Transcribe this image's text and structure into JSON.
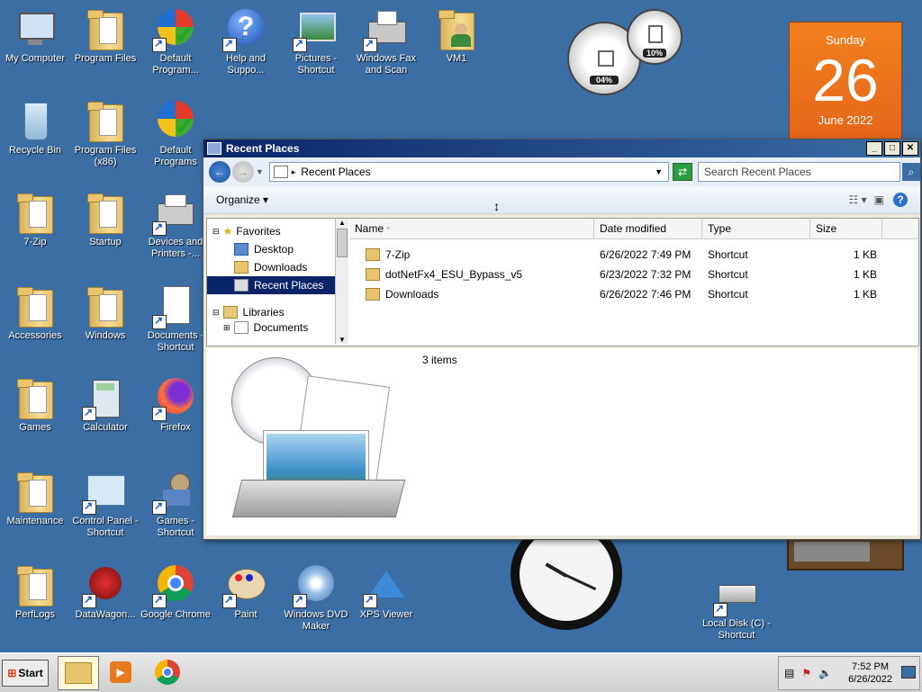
{
  "colors": {
    "desktop_bg": "#3a6ea5",
    "title_active": "#0a246a",
    "calendar_orange": "#f2801e",
    "selection": "#0a246a"
  },
  "desktop_icons": [
    {
      "label": "My Computer",
      "icon": "computer-icon"
    },
    {
      "label": "Program Files",
      "icon": "folder-icon"
    },
    {
      "label": "Default Program...",
      "icon": "default-programs-icon"
    },
    {
      "label": "Help and Suppo...",
      "icon": "help-icon"
    },
    {
      "label": "Pictures - Shortcut",
      "icon": "pictures-icon"
    },
    {
      "label": "Windows Fax and Scan",
      "icon": "fax-icon"
    },
    {
      "label": "VM1",
      "icon": "user-folder-icon"
    },
    {
      "label": "Recycle Bin",
      "icon": "recycle-bin-icon"
    },
    {
      "label": "Program Files (x86)",
      "icon": "folder-icon"
    },
    {
      "label": "Default Programs",
      "icon": "default-programs-icon"
    },
    {
      "label": "7-Zip",
      "icon": "folder-icon"
    },
    {
      "label": "Startup",
      "icon": "folder-icon"
    },
    {
      "label": "Devices and Printers -...",
      "icon": "printer-icon"
    },
    {
      "label": "Accessories",
      "icon": "folder-icon"
    },
    {
      "label": "Windows",
      "icon": "folder-icon"
    },
    {
      "label": "Documents - Shortcut",
      "icon": "documents-icon"
    },
    {
      "label": "Games",
      "icon": "folder-icon"
    },
    {
      "label": "Calculator",
      "icon": "calculator-icon"
    },
    {
      "label": "Firefox",
      "icon": "firefox-icon"
    },
    {
      "label": "Maintenance",
      "icon": "folder-icon"
    },
    {
      "label": "Control Panel - Shortcut",
      "icon": "control-panel-icon"
    },
    {
      "label": "Games - Shortcut",
      "icon": "games-icon"
    },
    {
      "label": "PerfLogs",
      "icon": "folder-icon"
    },
    {
      "label": "DataWagon...",
      "icon": "datawagon-icon"
    },
    {
      "label": "Google Chrome",
      "icon": "chrome-icon"
    },
    {
      "label": "Paint",
      "icon": "paint-icon"
    },
    {
      "label": "Windows DVD Maker",
      "icon": "dvd-maker-icon"
    },
    {
      "label": "XPS Viewer",
      "icon": "xps-viewer-icon"
    },
    {
      "label": "Local Disk (C) - Shortcut",
      "icon": "local-disk-icon"
    }
  ],
  "gadgets": {
    "cpu_meter": {
      "cpu_percent": "04%",
      "memory_percent": "10%"
    },
    "calendar": {
      "weekday": "Sunday",
      "day": "26",
      "month_year": "June 2022"
    }
  },
  "window": {
    "title": "Recent Places",
    "address": "Recent Places",
    "search_placeholder": "Search Recent Places",
    "organize_label": "Organize",
    "nav": {
      "favorites": "Favorites",
      "desktop": "Desktop",
      "downloads": "Downloads",
      "recent_places": "Recent Places",
      "libraries": "Libraries",
      "documents": "Documents"
    },
    "columns": {
      "name": "Name",
      "date_modified": "Date modified",
      "type": "Type",
      "size": "Size"
    },
    "files": [
      {
        "name": "7-Zip",
        "date": "6/26/2022 7:49 PM",
        "type": "Shortcut",
        "size": "1 KB"
      },
      {
        "name": "dotNetFx4_ESU_Bypass_v5",
        "date": "6/23/2022 7:32 PM",
        "type": "Shortcut",
        "size": "1 KB"
      },
      {
        "name": "Downloads",
        "date": "6/26/2022 7:46 PM",
        "type": "Shortcut",
        "size": "1 KB"
      }
    ],
    "item_count": "3 items"
  },
  "taskbar": {
    "start_label": "Start",
    "time": "7:52 PM",
    "date": "6/26/2022"
  }
}
